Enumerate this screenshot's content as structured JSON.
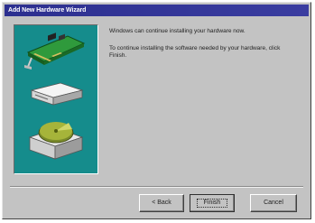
{
  "window": {
    "title": "Add New Hardware Wizard"
  },
  "content": {
    "message1": "Windows can continue installing your hardware now.",
    "message2": "To continue installing the software needed by your hardware, click Finish."
  },
  "buttons": {
    "back": "< Back",
    "finish": "Finish",
    "cancel": "Cancel"
  },
  "illustration": {
    "icons": [
      "expansion-card-icon",
      "external-drive-icon",
      "disk-drive-icon"
    ]
  }
}
